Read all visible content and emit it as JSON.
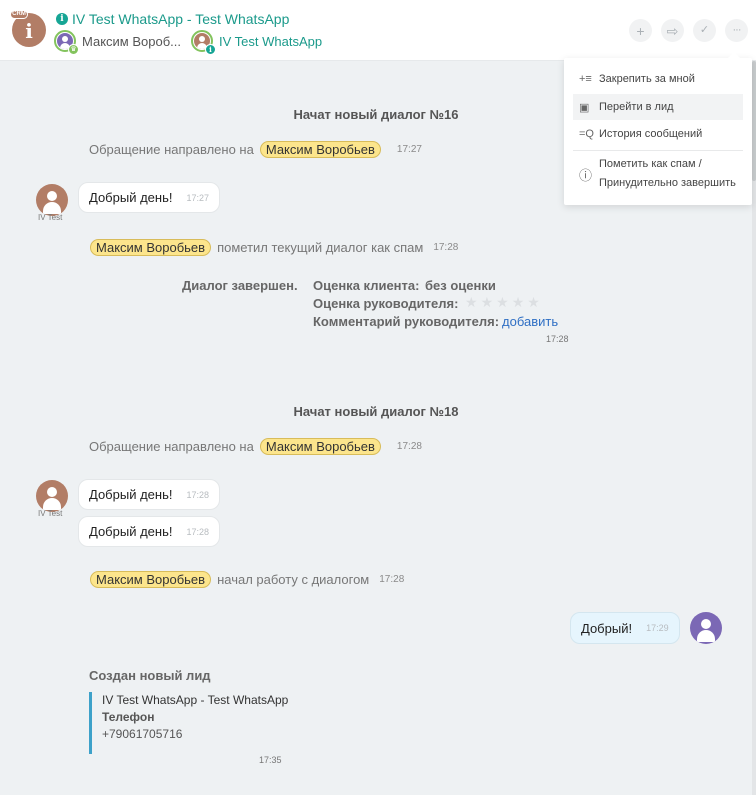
{
  "header": {
    "crm_tag": "CRM",
    "crm_letter": "i",
    "title": "IV Test WhatsApp - Test WhatsApp",
    "members": [
      {
        "name": "Максим Вороб...",
        "avatar_color": "#7b68b5",
        "badge": "crown"
      },
      {
        "name": "IV Test WhatsApp",
        "avatar_color": "#b27d66",
        "badge": "info"
      }
    ],
    "actions": [
      {
        "name": "add",
        "glyph": "+"
      },
      {
        "name": "transfer",
        "glyph": "⇨"
      },
      {
        "name": "finish",
        "glyph": "✓"
      },
      {
        "name": "more",
        "glyph": "···"
      }
    ]
  },
  "menu": {
    "items": [
      {
        "icon": "+≡",
        "label": "Закрепить за мной"
      },
      {
        "icon": "▣",
        "label": "Перейти в лид"
      },
      {
        "icon": "=Q",
        "label": "История сообщений"
      },
      {
        "icon": "ⓘ",
        "label_line1": "Пометить как спам /",
        "label_line2": "Принудительно завершить"
      }
    ]
  },
  "chat": {
    "dialog16": {
      "start": "Начат новый диалог №16",
      "routed_prefix": "Обращение направлено на",
      "routed_to": "Максим Воробьев",
      "routed_time": "17:27",
      "msg_author": "IV Test",
      "msg_text": "Добрый день!",
      "msg_time": "17:27",
      "spam_user": "Максим Воробьев",
      "spam_text": "пометил текущий диалог как спам",
      "spam_time": "17:28",
      "summary": {
        "finished": "Диалог завершен.",
        "client_rating_label": "Оценка клиента:",
        "client_rating_value": "без оценки",
        "manager_rating_label": "Оценка руководителя:",
        "manager_rating_stars": 0,
        "manager_rating_max": 5,
        "comment_label": "Комментарий руководителя:",
        "comment_link": "добавить",
        "time": "17:28"
      }
    },
    "dialog18": {
      "start": "Начат новый диалог №18",
      "routed_prefix": "Обращение направлено на",
      "routed_to": "Максим Воробьев",
      "routed_time": "17:28",
      "msg_author": "IV Test",
      "messages": [
        {
          "text": "Добрый день!",
          "time": "17:28"
        },
        {
          "text": "Добрый день!",
          "time": "17:28"
        }
      ],
      "started_user": "Максим Воробьев",
      "started_text": "начал работу с диалогом",
      "started_time": "17:28",
      "outgoing": {
        "text": "Добрый!",
        "time": "17:29"
      },
      "lead": {
        "title": "Создан новый лид",
        "name": "IV Test WhatsApp - Test WhatsApp",
        "phone_label": "Телефон",
        "phone": "+79061705716",
        "time": "17:35"
      }
    }
  }
}
